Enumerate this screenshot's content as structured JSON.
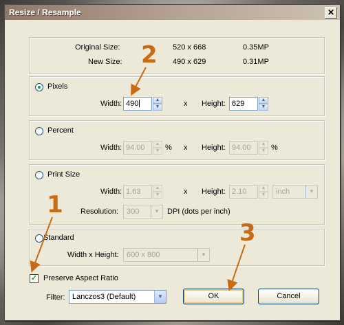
{
  "window": {
    "title": "Resize / Resample",
    "close_glyph": "✕"
  },
  "info": {
    "original_label": "Original Size:",
    "original_dims": "520 x 668",
    "original_mp": "0.35MP",
    "new_label": "New Size:",
    "new_dims": "490 x 629",
    "new_mp": "0.31MP"
  },
  "pixels": {
    "label": "Pixels",
    "selected": true,
    "width_label": "Width:",
    "width_value": "490",
    "x": "x",
    "height_label": "Height:",
    "height_value": "629"
  },
  "percent": {
    "label": "Percent",
    "width_label": "Width:",
    "width_value": "94.00",
    "width_unit": "%",
    "x": "x",
    "height_label": "Height:",
    "height_value": "94.00",
    "height_unit": "%"
  },
  "print_size": {
    "label": "Print Size",
    "width_label": "Width:",
    "width_value": "1.63",
    "x": "x",
    "height_label": "Height:",
    "height_value": "2.10",
    "unit": "inch",
    "resolution_label": "Resolution:",
    "resolution_value": "300",
    "resolution_unit": "DPI (dots per inch)"
  },
  "standard": {
    "label": "Standard",
    "wh_label": "Width x Height:",
    "wh_value": "600 x 800"
  },
  "options": {
    "preserve_label": "Preserve Aspect Ratio",
    "preserve_checked": true,
    "filter_label": "Filter:",
    "filter_value": "Lanczos3 (Default)"
  },
  "buttons": {
    "ok": "OK",
    "cancel": "Cancel"
  },
  "annotations": {
    "one": "1",
    "two": "2",
    "three": "3",
    "color": "#c96a14"
  },
  "colors": {
    "arrow": "#c96a14",
    "radio_dot": "#21a121"
  }
}
